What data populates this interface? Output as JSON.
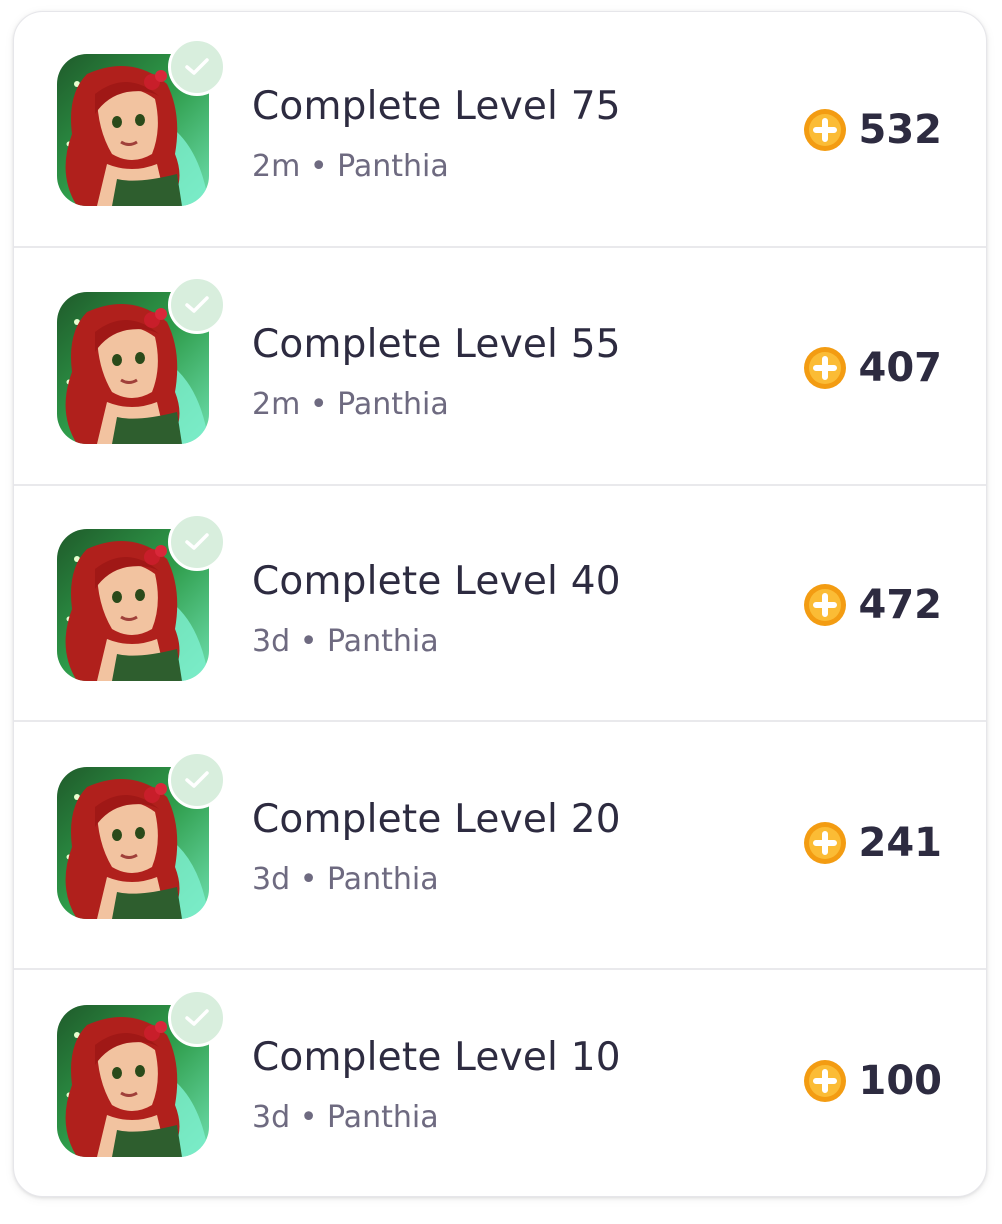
{
  "theme": {
    "coin_color": "#f6a21a",
    "check_bg": "#d8eedd",
    "title_color": "#2d2b40",
    "meta_color": "#6e6a80"
  },
  "items": [
    {
      "title": "Complete Level 75",
      "time": "2m",
      "author": "Panthia",
      "reward": "532",
      "icon": "game-thumbnail",
      "completed": true
    },
    {
      "title": "Complete Level 55",
      "time": "2m",
      "author": "Panthia",
      "reward": "407",
      "icon": "game-thumbnail",
      "completed": true
    },
    {
      "title": "Complete Level 40",
      "time": "3d",
      "author": "Panthia",
      "reward": "472",
      "icon": "game-thumbnail",
      "completed": true
    },
    {
      "title": "Complete Level 20",
      "time": "3d",
      "author": "Panthia",
      "reward": "241",
      "icon": "game-thumbnail",
      "completed": true
    },
    {
      "title": "Complete Level 10",
      "time": "3d",
      "author": "Panthia",
      "reward": "100",
      "icon": "game-thumbnail",
      "completed": true
    }
  ],
  "separator": "•"
}
